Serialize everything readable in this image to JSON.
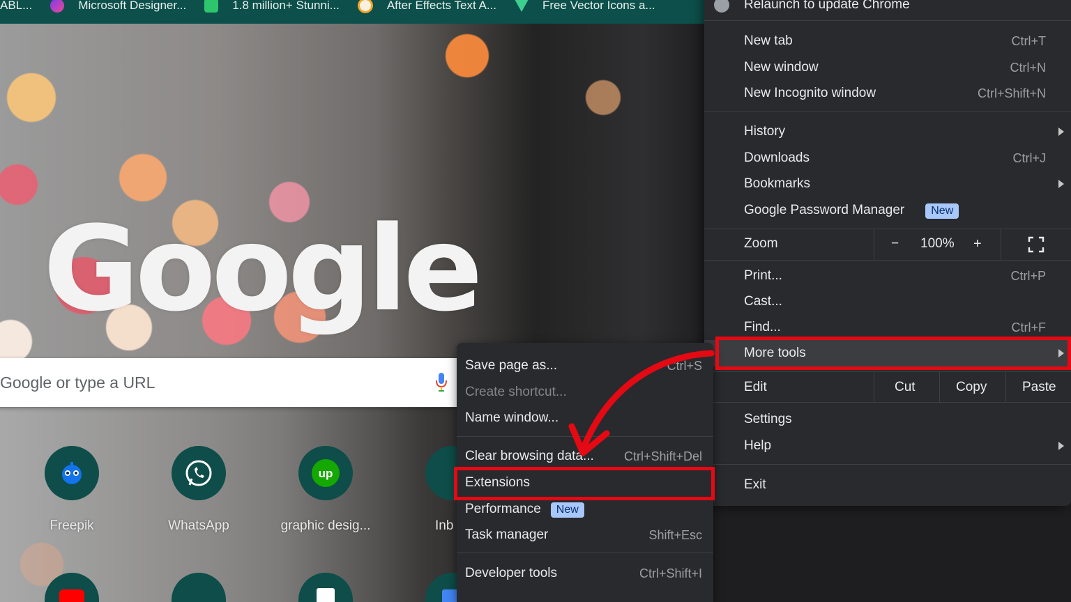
{
  "bookmarks_bar": {
    "items": [
      {
        "label": "ABL...",
        "icon": "bookmark-favicon",
        "color": ""
      },
      {
        "label": "Microsoft Designer...",
        "icon": "designer-favicon",
        "color": "#8b5cf6"
      },
      {
        "label": "1.8 million+ Stunni...",
        "icon": "pixabay-favicon",
        "color": "#2ec66d"
      },
      {
        "label": "After Effects Text A...",
        "icon": "after-effects-favicon",
        "color": "#f5a623"
      },
      {
        "label": "Free Vector Icons a...",
        "icon": "flaticon-favicon",
        "color": "#3ecf8e"
      }
    ]
  },
  "ntp": {
    "logo": "Google",
    "search_placeholder": "Google or type a URL",
    "shortcuts": [
      {
        "label": "Freepik",
        "icon": "freepik-icon"
      },
      {
        "label": "WhatsApp",
        "icon": "whatsapp-icon"
      },
      {
        "label": "graphic desig...",
        "icon": "upwork-icon"
      },
      {
        "label": "Inb",
        "icon": "gmail-icon"
      }
    ]
  },
  "main_menu": {
    "relaunch": "Relaunch to update Chrome",
    "new_tab": {
      "label": "New tab",
      "shortcut": "Ctrl+T"
    },
    "new_window": {
      "label": "New window",
      "shortcut": "Ctrl+N"
    },
    "new_incognito": {
      "label": "New Incognito window",
      "shortcut": "Ctrl+Shift+N"
    },
    "history": {
      "label": "History"
    },
    "downloads": {
      "label": "Downloads",
      "shortcut": "Ctrl+J"
    },
    "bookmarks": {
      "label": "Bookmarks"
    },
    "password_manager": {
      "label": "Google Password Manager",
      "badge": "New"
    },
    "zoom": {
      "label": "Zoom",
      "minus": "−",
      "value": "100%",
      "plus": "+"
    },
    "print": {
      "label": "Print...",
      "shortcut": "Ctrl+P"
    },
    "cast": {
      "label": "Cast..."
    },
    "find": {
      "label": "Find...",
      "shortcut": "Ctrl+F"
    },
    "more_tools": {
      "label": "More tools"
    },
    "edit": {
      "label": "Edit",
      "cut": "Cut",
      "copy": "Copy",
      "paste": "Paste"
    },
    "settings": {
      "label": "Settings"
    },
    "help": {
      "label": "Help"
    },
    "exit": {
      "label": "Exit"
    }
  },
  "sub_menu": {
    "save_page": {
      "label": "Save page as...",
      "shortcut": "Ctrl+S"
    },
    "create_shortcut": {
      "label": "Create shortcut..."
    },
    "name_window": {
      "label": "Name window..."
    },
    "clear_browsing": {
      "label": "Clear browsing data...",
      "shortcut": "Ctrl+Shift+Del"
    },
    "extensions": {
      "label": "Extensions"
    },
    "performance": {
      "label": "Performance",
      "badge": "New"
    },
    "task_manager": {
      "label": "Task manager",
      "shortcut": "Shift+Esc"
    },
    "developer_tools": {
      "label": "Developer tools",
      "shortcut": "Ctrl+Shift+I"
    }
  },
  "annotation_color": "#e50914"
}
